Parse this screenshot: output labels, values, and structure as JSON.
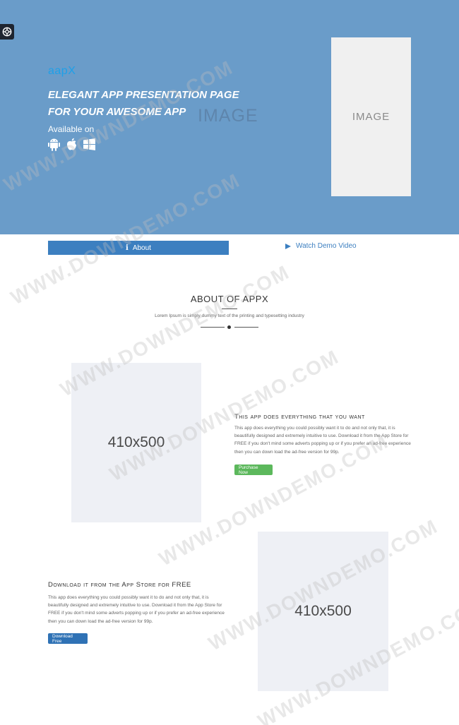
{
  "hero": {
    "brand": "aapX",
    "headline_line1": "ELEGANT APP PRESENTATION PAGE",
    "headline_line2": "FOR YOUR AWESOME APP",
    "available_on": "Available on",
    "store_icons": [
      "android-icon",
      "apple-icon",
      "windows-icon"
    ],
    "image_text": "IMAGE",
    "phone_image_text": "IMAGE",
    "background_color": "#6a9cc9",
    "brand_color": "#1ea0e8"
  },
  "corner_button": {
    "icon": "lifebuoy-icon"
  },
  "tabs": {
    "about_icon": "info-icon",
    "about_label": "About",
    "video_icon": "play-icon",
    "video_label": "Watch Demo Video",
    "accent_color": "#3c7fc0"
  },
  "about": {
    "title": "ABOUT OF APPX",
    "subtitle": "Lorem Ipsum is simply dummy text of the printing and typesetting industry"
  },
  "feature1": {
    "image_label": "410x500",
    "title": "This app does everything that you want",
    "text": "This app does everything you could possibly want it to do and not only that, it is beautifully designed and extremely intuitive to use. Download it from the App Store for FREE if you don't mind some adverts popping up or if you prefer an ad-free experience then you can down load the ad-free version for 99p.",
    "button_label": "Purchase Now",
    "button_color": "#5cb85c"
  },
  "feature2": {
    "image_label": "410x500",
    "title": "Download it from the App Store for FREE",
    "text": "This app does everything you could possibly want it to do and not only that, it is beautifully designed and extremely intuitive to use. Download it from the App Store for FREE if you don't mind some adverts popping up or if you prefer an ad-free experience then you can down load the ad-free version for 99p.",
    "button_label": "Download Free",
    "button_color": "#2f72b5"
  },
  "watermark": "WWW.DOWNDEMO.COM"
}
